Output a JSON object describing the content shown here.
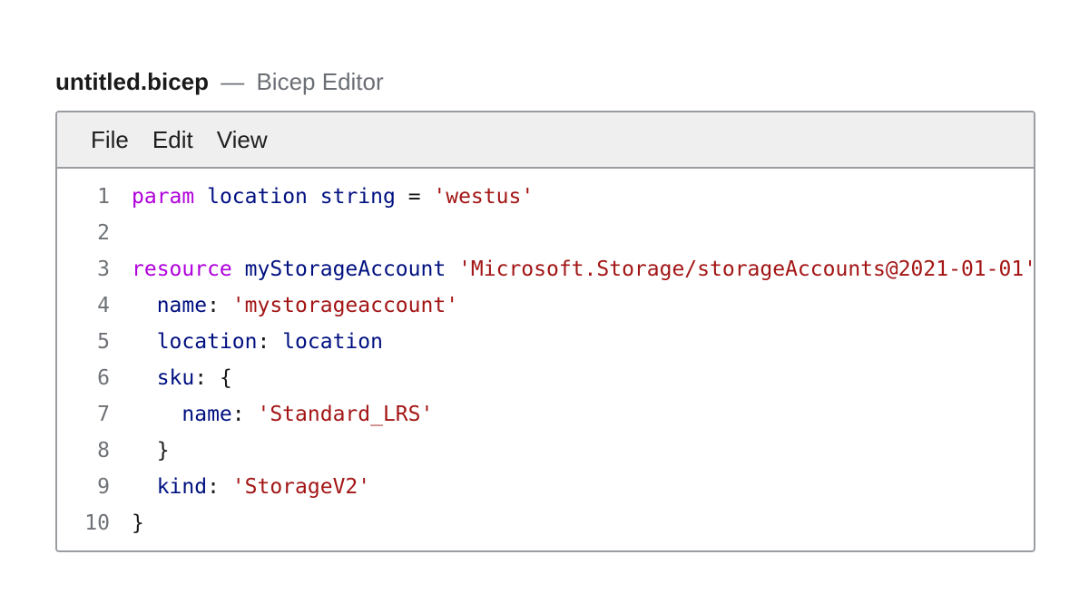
{
  "window": {
    "file_name": "untitled.bicep",
    "separator": "—",
    "app_name": "Bicep Editor"
  },
  "menu": {
    "items": [
      "File",
      "Edit",
      "View"
    ]
  },
  "colors": {
    "keyword": "#af00db",
    "identifier": "#001080",
    "string": "#a31515",
    "plain": "#1a1a1a",
    "menubar_bg": "#efefef",
    "border": "#9a9da1"
  },
  "code": {
    "lines": [
      {
        "number": "1",
        "tokens": [
          {
            "t": "kw",
            "v": "param"
          },
          {
            "t": "op",
            "v": " "
          },
          {
            "t": "id",
            "v": "location"
          },
          {
            "t": "op",
            "v": " "
          },
          {
            "t": "id",
            "v": "string"
          },
          {
            "t": "op",
            "v": " = "
          },
          {
            "t": "str",
            "v": "'westus'"
          }
        ]
      },
      {
        "number": "2",
        "tokens": []
      },
      {
        "number": "3",
        "tokens": [
          {
            "t": "kw",
            "v": "resource"
          },
          {
            "t": "op",
            "v": " "
          },
          {
            "t": "id",
            "v": "myStorageAccount"
          },
          {
            "t": "op",
            "v": " "
          },
          {
            "t": "str",
            "v": "'Microsoft.Storage/storageAccounts@2021-01-01'"
          }
        ]
      },
      {
        "number": "4",
        "tokens": [
          {
            "t": "op",
            "v": "  "
          },
          {
            "t": "id",
            "v": "name"
          },
          {
            "t": "op",
            "v": ": "
          },
          {
            "t": "str",
            "v": "'mystorageaccount'"
          }
        ]
      },
      {
        "number": "5",
        "tokens": [
          {
            "t": "op",
            "v": "  "
          },
          {
            "t": "id",
            "v": "location"
          },
          {
            "t": "op",
            "v": ": "
          },
          {
            "t": "id",
            "v": "location"
          }
        ]
      },
      {
        "number": "6",
        "tokens": [
          {
            "t": "op",
            "v": "  "
          },
          {
            "t": "id",
            "v": "sku"
          },
          {
            "t": "op",
            "v": ": {"
          }
        ]
      },
      {
        "number": "7",
        "tokens": [
          {
            "t": "op",
            "v": "    "
          },
          {
            "t": "id",
            "v": "name"
          },
          {
            "t": "op",
            "v": ": "
          },
          {
            "t": "str",
            "v": "'Standard_LRS'"
          }
        ]
      },
      {
        "number": "8",
        "tokens": [
          {
            "t": "op",
            "v": "  }"
          }
        ]
      },
      {
        "number": "9",
        "tokens": [
          {
            "t": "op",
            "v": "  "
          },
          {
            "t": "id",
            "v": "kind"
          },
          {
            "t": "op",
            "v": ": "
          },
          {
            "t": "str",
            "v": "'StorageV2'"
          }
        ]
      },
      {
        "number": "10",
        "tokens": [
          {
            "t": "op",
            "v": "}"
          }
        ]
      }
    ]
  }
}
